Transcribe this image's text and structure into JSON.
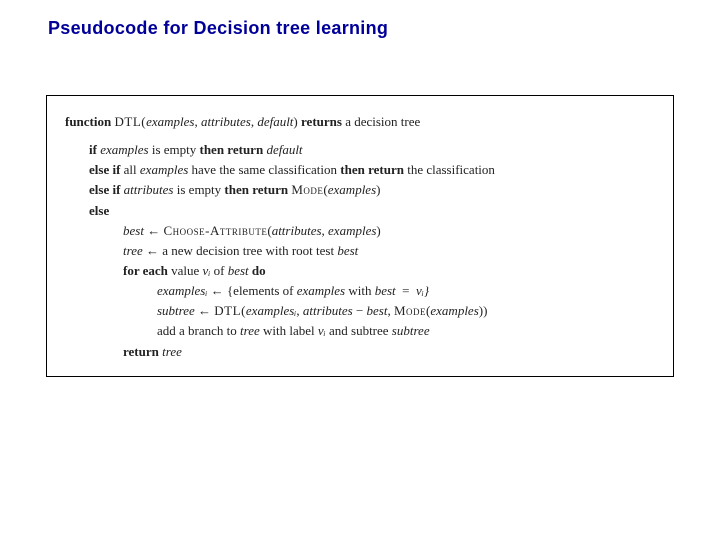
{
  "title": "Pseudocode for Decision tree learning",
  "kw": {
    "function": "function",
    "returns": "returns",
    "if": "if",
    "then_return": "then return",
    "else_if": "else if",
    "else": "else",
    "for_each": "for each",
    "do": "do",
    "return": "return"
  },
  "w": {
    "DTL_open": "DTL(",
    "examples": "examples",
    "attributes": "attributes",
    "default": "default",
    "close": ")",
    "a_decision_tree": "a decision tree",
    "is_empty": "is empty",
    "all": "all",
    "have_same_class": "have the same classification",
    "the_classification": "the classification",
    "MODE": "Mode",
    "open": "(",
    "best": "best",
    "tree": "tree",
    "subtree": "subtree",
    "assign": "←",
    "CHOOSE_ATTR": "Choose-Attribute",
    "comma": ", ",
    "new_tree_with_root": "a new decision tree with root test",
    "value": "value",
    "v_i": "vᵢ",
    "of": "of",
    "examples_i": "examplesᵢ",
    "elements_of": "{elements of",
    "with": "with",
    "eq": "=",
    "vi_close": "vᵢ}",
    "minus": "−",
    "close2": "))",
    "add_branch": "add a branch to",
    "with_label": "with label",
    "and_subtree": "and subtree"
  }
}
